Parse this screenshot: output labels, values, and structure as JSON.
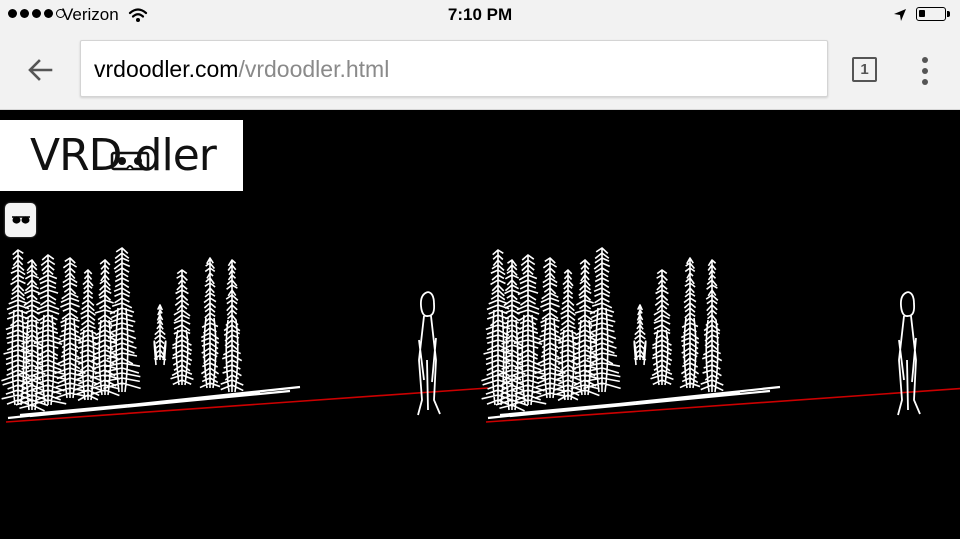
{
  "status_bar": {
    "signal_dots": [
      true,
      true,
      true,
      true,
      false
    ],
    "carrier": "Verizon",
    "time": "7:10 PM",
    "battery_level": 0.25,
    "icons": [
      "wifi-icon",
      "location-arrow-icon",
      "battery-icon"
    ]
  },
  "toolbar": {
    "url_host": "vrdoodler.com",
    "url_path": "/vrdoodler.html",
    "tab_count": "1",
    "icons": [
      "back-arrow-icon",
      "tab-switcher-icon",
      "overflow-menu-icon"
    ]
  },
  "page": {
    "logo_text": "VRD  dler",
    "vr_mode_icon": "cardboard-glasses-icon",
    "colors": {
      "background": "#000000",
      "strokes": "#ffffff",
      "ground_line": "#cc0000"
    }
  }
}
